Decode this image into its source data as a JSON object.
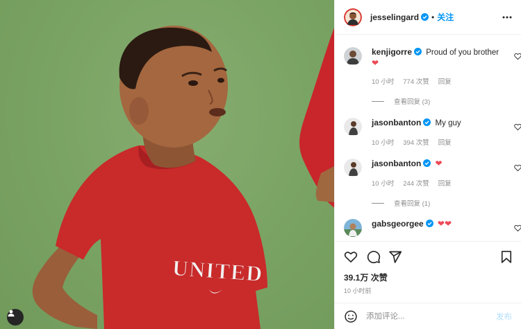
{
  "post": {
    "author": "jesselingard",
    "follow_label": "关注",
    "separator": "•",
    "photo_shirt_text": "UNITED",
    "likes": "39.1万 次赞",
    "time": "10 小时前"
  },
  "comments": [
    {
      "user": "kenjigorre",
      "text": "Proud of you brother",
      "hearts": "❤",
      "time": "10 小时",
      "likes": "774 次赞",
      "reply": "回复",
      "view_replies": "查看回复 (3)"
    },
    {
      "user": "jasonbanton",
      "text": "My guy",
      "hearts": "",
      "time": "10 小时",
      "likes": "394 次赞",
      "reply": "回复",
      "view_replies": ""
    },
    {
      "user": "jasonbanton",
      "text": "",
      "hearts": "❤",
      "time": "10 小时",
      "likes": "244 次赞",
      "reply": "回复",
      "view_replies": "查看回复 (1)"
    },
    {
      "user": "gabsgeorgee",
      "text": "",
      "hearts": "❤❤",
      "time": "",
      "likes": "",
      "reply": "",
      "view_replies": ""
    }
  ],
  "composer": {
    "placeholder": "添加评论...",
    "post_label": "发布"
  },
  "icons": {
    "more": "more-options-icon",
    "like": "heart-icon",
    "comment": "comment-icon",
    "share": "share-icon",
    "save": "bookmark-icon",
    "emoji": "emoji-icon",
    "verified": "verified-badge-icon",
    "user": "user-icon"
  },
  "colors": {
    "accent": "#0095f6",
    "heart_red": "#ed4956",
    "muted": "#8e8e8e",
    "text": "#262626"
  }
}
